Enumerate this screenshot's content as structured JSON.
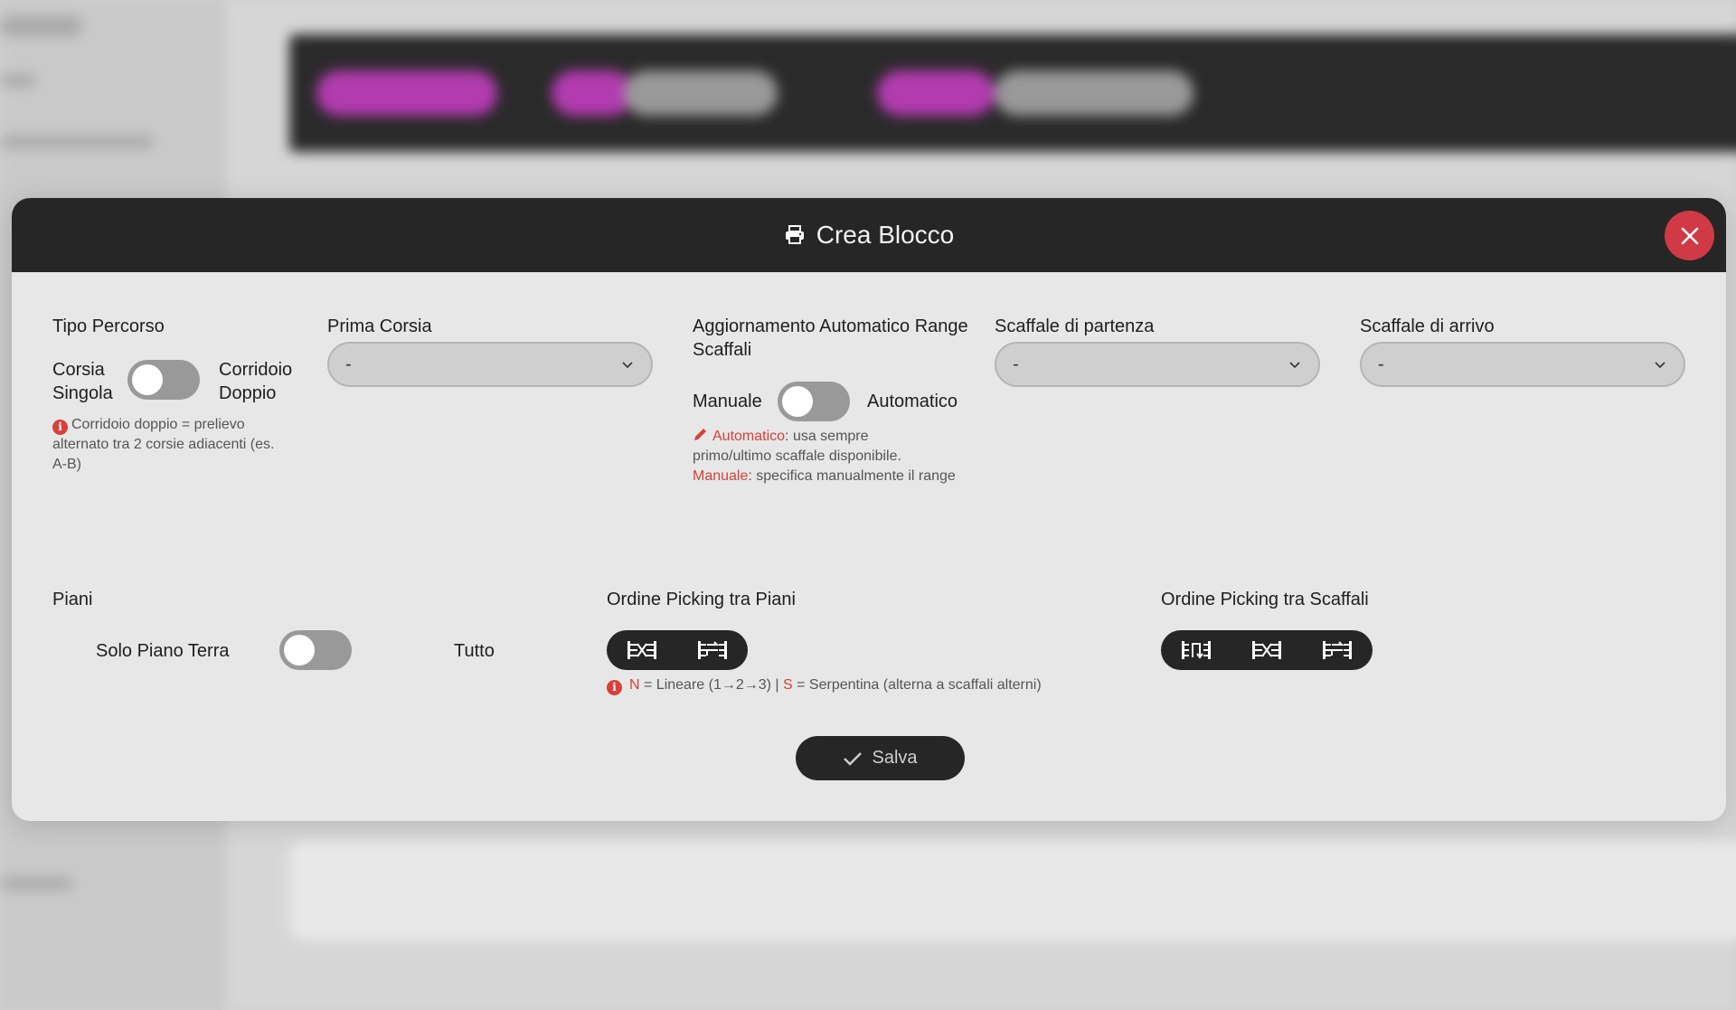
{
  "modal": {
    "title": "Crea Blocco",
    "title_icon": "printer-icon",
    "close_icon": "close-icon"
  },
  "tipo_percorso": {
    "label": "Tipo Percorso",
    "left_label_line1": "Corsia",
    "left_label_line2": "Singola",
    "right_label_line1": "Corridoio",
    "right_label_line2": "Doppio",
    "toggle_on": false,
    "note_line1": "Corridoio doppio = prelievo",
    "note_line2": "alternato tra 2 corsie adiacenti (es.",
    "note_line3": "A-B)"
  },
  "prima_corsia": {
    "label": "Prima Corsia",
    "value": "-"
  },
  "aggiornamento": {
    "label_line1": "Aggiornamento Automatico Range",
    "label_line2": "Scaffali",
    "left_label": "Manuale",
    "right_label": "Automatico",
    "toggle_on": false,
    "note_auto_key": "Automatico",
    "note_auto_text": ": usa sempre",
    "note_line2": "primo/ultimo scaffale disponibile.",
    "note_manual_key": "Manuale",
    "note_manual_text": ": specifica manualmente il range"
  },
  "scaffale_partenza": {
    "label": "Scaffale di partenza",
    "value": "-"
  },
  "scaffale_arrivo": {
    "label": "Scaffale di arrivo",
    "value": "-"
  },
  "piani": {
    "label": "Piani",
    "left_label": "Solo Piano Terra",
    "right_label": "Tutto",
    "toggle_on": false
  },
  "ordine_piani": {
    "label": "Ordine Picking tra Piani",
    "buttons": [
      "linear-order-icon",
      "serpentine-order-icon"
    ],
    "legend_n": "N",
    "legend_n_text": " = Lineare (1→2→3) | ",
    "legend_s": "S",
    "legend_s_text": " = Serpentina (alterna a scaffali alterni)"
  },
  "ordine_scaffali": {
    "label": "Ordine Picking tra Scaffali",
    "buttons": [
      "vertical-order-icon",
      "linear-order-icon",
      "serpentine-order-icon"
    ]
  },
  "save": {
    "label": "Salva",
    "icon": "check-icon"
  },
  "colors": {
    "header_bg": "#262626",
    "close_bg": "#d03a44",
    "accent_red": "#d8403a",
    "modal_bg": "#e7e7e7"
  }
}
